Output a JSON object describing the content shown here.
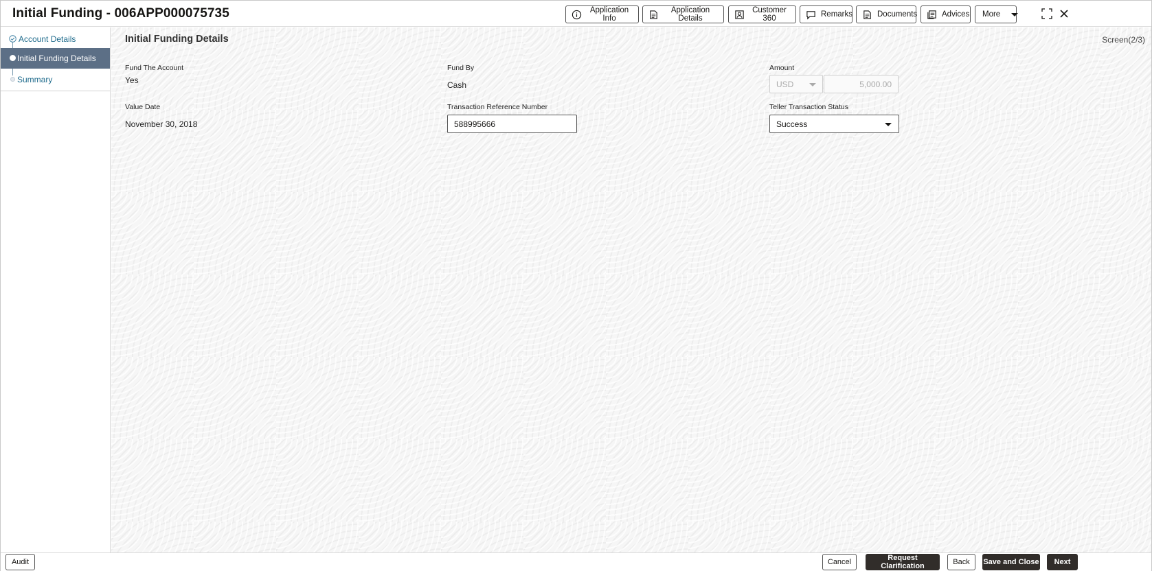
{
  "header": {
    "title": "Initial Funding - 006APP000075735",
    "buttons": [
      {
        "label": "Application Info",
        "icon": "info-icon"
      },
      {
        "label": "Application Details",
        "icon": "document-icon"
      },
      {
        "label": "Customer 360",
        "icon": "user-icon"
      },
      {
        "label": "Remarks",
        "icon": "chat-icon"
      },
      {
        "label": "Documents",
        "icon": "document-icon"
      },
      {
        "label": "Advices",
        "icon": "advices-icon"
      }
    ],
    "more_label": "More"
  },
  "sidebar": {
    "steps": [
      {
        "label": "Account Details",
        "state": "completed"
      },
      {
        "label": "Initial Funding Details",
        "state": "active"
      },
      {
        "label": "Summary",
        "state": "pending"
      }
    ]
  },
  "main": {
    "section_title": "Initial Funding Details",
    "screen_count": "Screen(2/3)",
    "fields": {
      "fund_the_account": {
        "label": "Fund The Account",
        "value": "Yes"
      },
      "fund_by": {
        "label": "Fund By",
        "value": "Cash"
      },
      "amount": {
        "label": "Amount",
        "currency": "USD",
        "value": "5,000.00"
      },
      "value_date": {
        "label": "Value Date",
        "value": "November 30, 2018"
      },
      "transaction_reference": {
        "label": "Transaction Reference Number",
        "value": "588995666"
      },
      "teller_status": {
        "label": "Teller Transaction Status",
        "value": "Success"
      }
    }
  },
  "footer": {
    "audit": "Audit",
    "cancel": "Cancel",
    "request_clarification": "Request Clarification",
    "back": "Back",
    "save_and_close": "Save and Close",
    "next": "Next"
  },
  "colors": {
    "accent_step": "#5c6f86",
    "link": "#1f6b8c",
    "dark_button": "#312d2a"
  }
}
